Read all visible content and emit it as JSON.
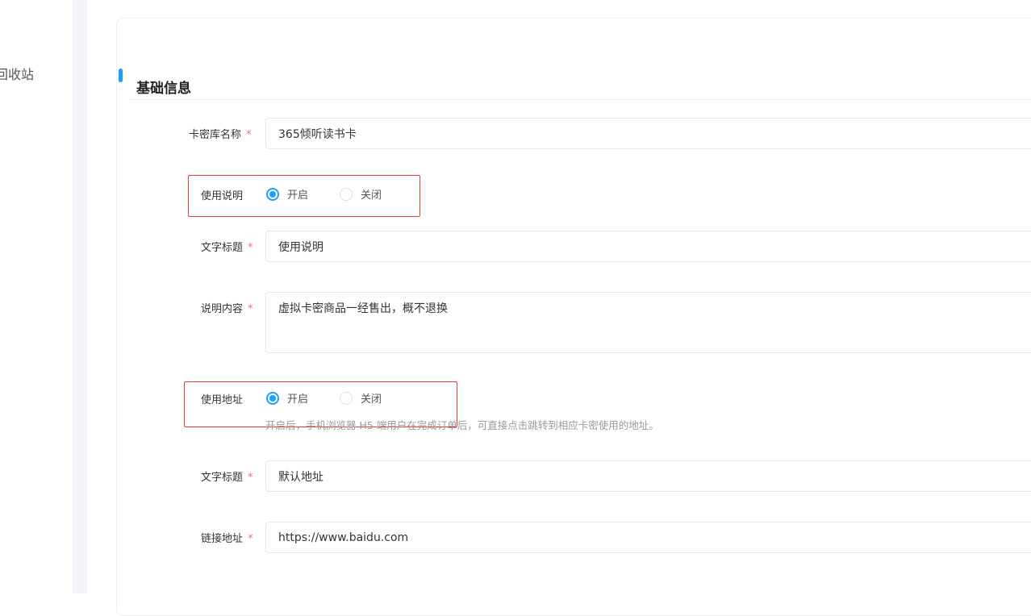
{
  "sidebar": {
    "recycle_bin_label": "回收站"
  },
  "section": {
    "title": "基础信息"
  },
  "fields": {
    "card_library_name": {
      "label": "卡密库名称",
      "required": "*",
      "value": "365倾听读书卡"
    },
    "usage_instructions": {
      "label": "使用说明",
      "options": [
        "开启",
        "关闭"
      ],
      "selected": "开启"
    },
    "instructions_title": {
      "label": "文字标题",
      "required": "*",
      "value": "使用说明"
    },
    "instructions_content": {
      "label": "说明内容",
      "required": "*",
      "value": "虚拟卡密商品一经售出，概不退换"
    },
    "usage_address": {
      "label": "使用地址",
      "options": [
        "开启",
        "关闭"
      ],
      "selected": "开启",
      "hint": "开启后，手机浏览器 H5 端用户在完成订单后，可直接点击跳转到相应卡密使用的地址。"
    },
    "address_title": {
      "label": "文字标题",
      "required": "*",
      "value": "默认地址"
    },
    "link_address": {
      "label": "链接地址",
      "required": "*",
      "value": "https://www.baidu.com"
    }
  },
  "colors": {
    "accent": "#1e9fff",
    "required": "#f56c6c",
    "highlight": "#e03a3a"
  }
}
